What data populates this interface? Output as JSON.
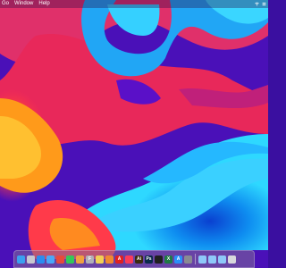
{
  "menubar": {
    "items": [
      "Go",
      "Window",
      "Help"
    ],
    "status_icons": [
      "wifi-icon",
      "control-center-icon"
    ]
  },
  "dock": {
    "apps": [
      {
        "name": "finder-icon",
        "color": "#3aa0f0"
      },
      {
        "name": "launchpad-icon",
        "color": "#c8c8d0"
      },
      {
        "name": "safari-icon",
        "color": "#2a8cf0"
      },
      {
        "name": "mail-icon",
        "color": "#4aa8f8"
      },
      {
        "name": "chrome-icon",
        "color": "#e84a3a"
      },
      {
        "name": "messages-icon",
        "color": "#34c759"
      },
      {
        "name": "photos-icon",
        "color": "#f0a040"
      },
      {
        "name": "font-book-icon",
        "color": "#b0b0b8",
        "glyph": "F"
      },
      {
        "name": "notes-icon",
        "color": "#f2d055"
      },
      {
        "name": "books-icon",
        "color": "#f08a30"
      },
      {
        "name": "acrobat-icon",
        "color": "#e02020",
        "glyph": "A"
      },
      {
        "name": "music-icon",
        "color": "#fa3c5a"
      },
      {
        "name": "illustrator-icon",
        "color": "#3a2a10",
        "glyph": "Ai"
      },
      {
        "name": "photoshop-icon",
        "color": "#0a2a4a",
        "glyph": "Ps"
      },
      {
        "name": "terminal-icon",
        "color": "#202020"
      },
      {
        "name": "excel-icon",
        "color": "#1f7a45",
        "glyph": "X"
      },
      {
        "name": "app-store-icon",
        "color": "#2a90f8",
        "glyph": "A"
      },
      {
        "name": "system-settings-icon",
        "color": "#8a8a92"
      }
    ],
    "others": [
      {
        "name": "folder-icon",
        "color": "#8ec8f8"
      },
      {
        "name": "downloads-folder-icon",
        "color": "#8ec8f8"
      },
      {
        "name": "documents-folder-icon",
        "color": "#8ec8f8"
      },
      {
        "name": "trash-icon",
        "color": "#d8d8dc"
      }
    ]
  }
}
